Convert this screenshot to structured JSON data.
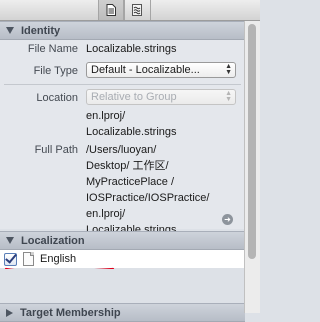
{
  "toolbar": {
    "buttons": [
      {
        "icon": "file-inspector-icon",
        "selected": true
      },
      {
        "icon": "quick-help-icon",
        "selected": false
      }
    ]
  },
  "identity": {
    "title": "Identity",
    "file_name_label": "File Name",
    "file_name_value": "Localizable.strings",
    "file_type_label": "File Type",
    "file_type_value": "Default - Localizable...",
    "location_label": "Location",
    "location_value": "Relative to Group",
    "location_path": "en.lproj/\nLocalizable.strings",
    "full_path_label": "Full Path",
    "full_path_value": "/Users/luoyan/\nDesktop/ 工作区/\nMyPracticePlace /\nIOSPractice/IOSPractice/\nen.lproj/\nLocalizable.strings"
  },
  "localization": {
    "title": "Localization",
    "items": [
      {
        "label": "English",
        "checked": true
      }
    ]
  },
  "target_membership": {
    "title": "Target Membership"
  },
  "colors": {
    "annotation_underline": "#e0001b",
    "checkmark": "#2b3e7c"
  }
}
